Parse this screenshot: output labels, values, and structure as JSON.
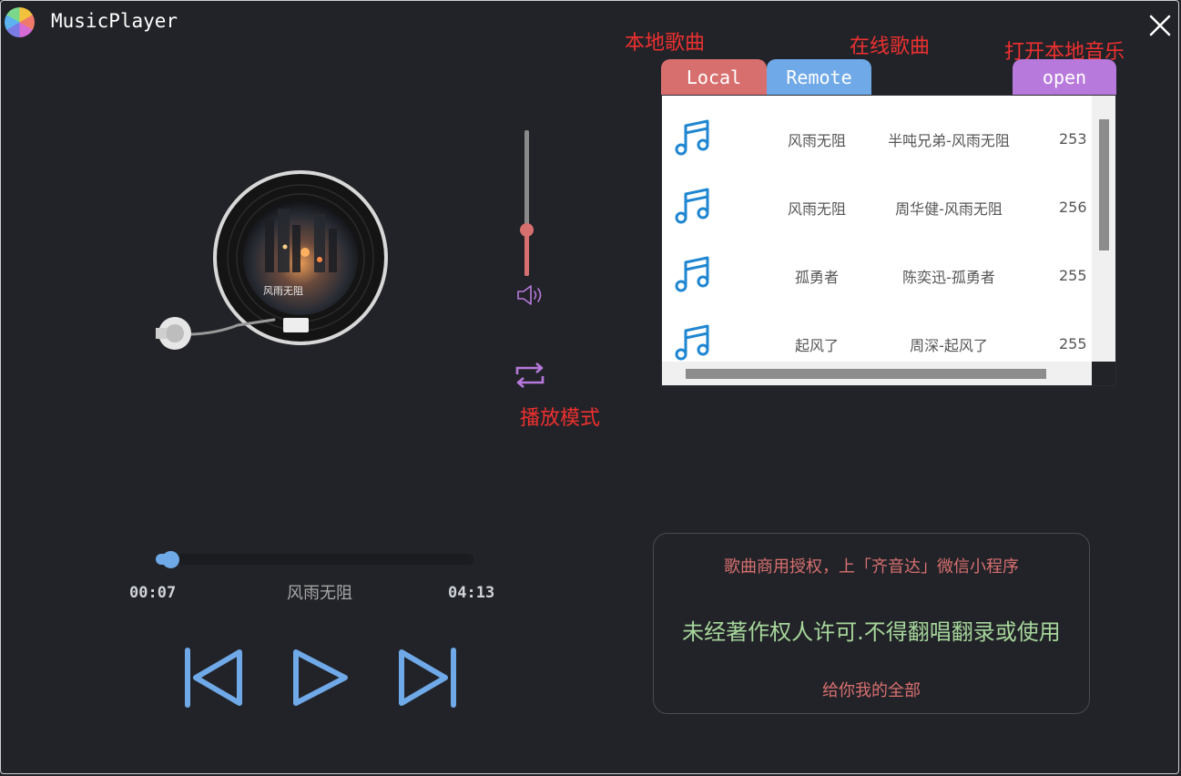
{
  "window": {
    "title": "MusicPlayer"
  },
  "annotations": {
    "local": "本地歌曲",
    "remote": "在线歌曲",
    "open": "打开本地音乐",
    "play_mode": "播放模式"
  },
  "tabs": {
    "local": "Local",
    "remote": "Remote",
    "open": "open"
  },
  "songs": [
    {
      "title": "风雨无阻",
      "artist": "半吨兄弟-风雨无阻",
      "num": "253"
    },
    {
      "title": "风雨无阻",
      "artist": "周华健-风雨无阻",
      "num": "256"
    },
    {
      "title": "孤勇者",
      "artist": "陈奕迅-孤勇者",
      "num": "255"
    },
    {
      "title": "起风了",
      "artist": "周深-起风了",
      "num": "255"
    }
  ],
  "player": {
    "current_time": "00:07",
    "total_time": "04:13",
    "now_playing": "风雨无阻",
    "progress": 0.03,
    "volume": 0.32
  },
  "album": {
    "cover_text": "风雨无阻"
  },
  "lyrics": {
    "top": "歌曲商用授权，上「齐音达」微信小程序",
    "current": "未经著作权人许可.不得翻唱翻录或使用",
    "bottom": "给你我的全部"
  },
  "colors": {
    "background": "#222328",
    "accent_blue": "#6fa9e8",
    "accent_red": "#d86f6f",
    "accent_purple": "#b779dc",
    "lyric_green": "#a6d69b",
    "annotation_red": "#ee3030"
  },
  "icons": {
    "logo": "color-wheel-logo",
    "close": "close-icon",
    "song": "music-note-icon",
    "volume": "speaker-icon",
    "mode": "repeat-icon",
    "prev": "skip-previous-icon",
    "play": "play-icon",
    "next": "skip-next-icon"
  }
}
